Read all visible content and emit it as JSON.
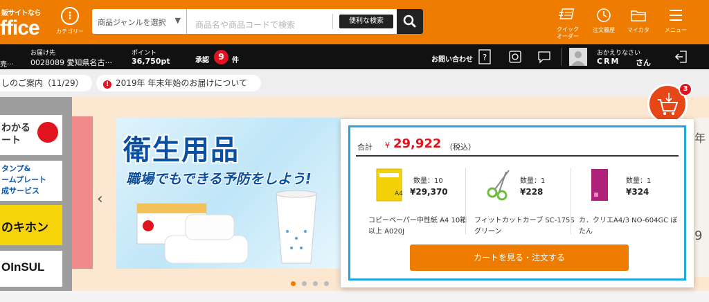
{
  "header": {
    "logo_small": "販サイトなら",
    "logo_big": "ffice",
    "category_label": "カテゴリー",
    "search": {
      "genre_select": "商品ジャンルを選択",
      "keyword_placeholder": "商品名や商品コードで検索",
      "convenient_search": "便利な検索"
    },
    "nav": [
      {
        "label": "クイック\nオーダー",
        "icon": "quick-order-icon"
      },
      {
        "label": "注文履歴",
        "icon": "order-history-icon"
      },
      {
        "label": "マイカタ",
        "icon": "folder-icon"
      },
      {
        "label": "メニュー",
        "icon": "hamburger-menu-icon"
      }
    ]
  },
  "account_bar": {
    "left_fragment": "売···",
    "delivery_label": "お届け先",
    "delivery_value": "0028089 愛知県名古···",
    "points_label": "ポイント",
    "points_value": "36,750pt",
    "approval_label": "承認",
    "approval_count": "9",
    "approval_unit": "件",
    "contact_label": "お問い合わせ",
    "greeting": "おかえりなさい",
    "user_name": "CRM",
    "user_suffix": "さん"
  },
  "notices": [
    {
      "text": "しのご案内（11/29）"
    },
    {
      "text": "2019年 年末年始のお届けについて"
    }
  ],
  "side_banners": [
    "わかる\nート",
    "タンプ&\nームプレート\n成サービス",
    "のキホン",
    "OInSUL"
  ],
  "slide": {
    "title": "衛生用品",
    "subtitle": "職場でもできる予防をしよう!"
  },
  "right_banner_text": "年",
  "right_banner_digit": "9",
  "cart": {
    "count": "3",
    "total_label": "合計",
    "total_yen": "¥",
    "total_value": "29,922",
    "tax_note": "（税込）",
    "items": [
      {
        "qty": "数量：10",
        "price": "¥29,370",
        "name": "コピーペーパー中性紙 A4 10箱以上 A020J",
        "icon": "copy-paper-icon",
        "color": "#f4d20a"
      },
      {
        "qty": "数量：1",
        "price": "¥228",
        "name": "フィットカットカーブ SC-175S グリーン",
        "icon": "scissors-icon",
        "color": "#6bbf3a"
      },
      {
        "qty": "数量：1",
        "price": "¥324",
        "name": "カ．クリエA4/3 NO-604GC ぼたん",
        "icon": "file-folder-icon",
        "color": "#b0217a"
      }
    ],
    "checkout_label": "カートを見る・注文する"
  },
  "colors": {
    "brand_orange": "#ee7c00",
    "badge_red": "#e0141e",
    "popup_border": "#21a7e0"
  }
}
